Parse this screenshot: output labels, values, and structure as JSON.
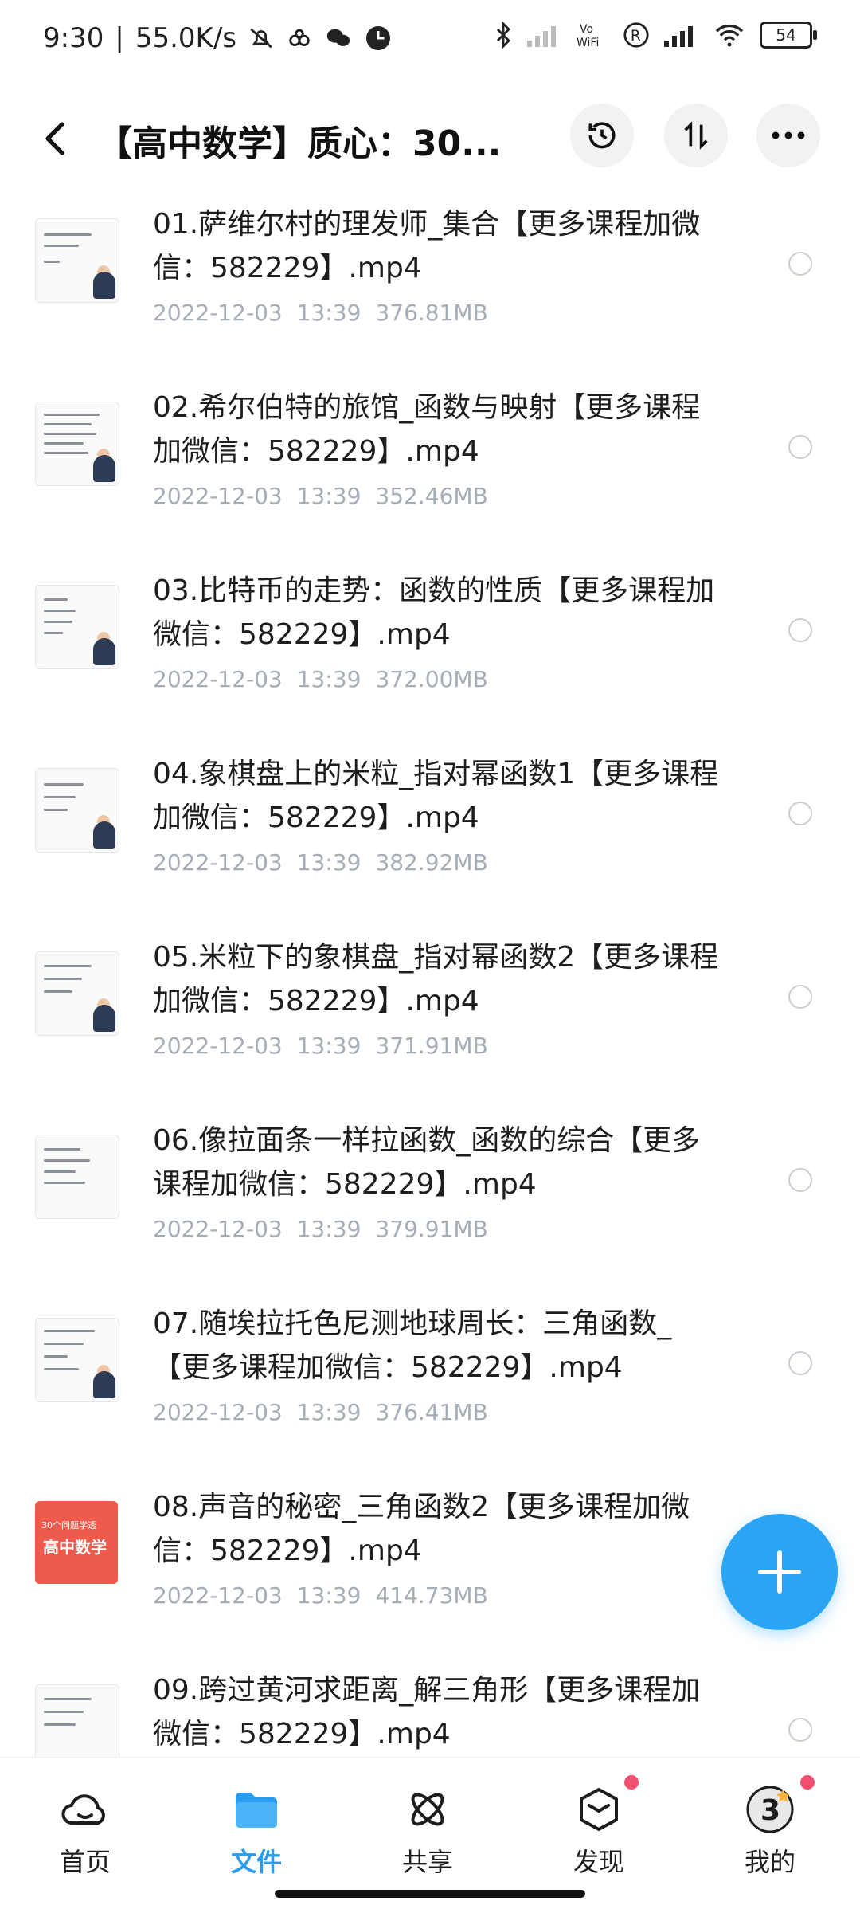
{
  "status_bar": {
    "time": "9:30",
    "separator": "|",
    "net_speed": "55.0K/s",
    "battery": "54"
  },
  "header": {
    "title": "【高中数学】质心：30..."
  },
  "files": [
    {
      "name": "01.萨维尔村的理发师_集合【更多课程加微信：582229】.mp4",
      "date": "2022-12-03",
      "time": "13:39",
      "size": "376.81MB"
    },
    {
      "name": "02.希尔伯特的旅馆_函数与映射【更多课程加微信：582229】.mp4",
      "date": "2022-12-03",
      "time": "13:39",
      "size": "352.46MB"
    },
    {
      "name": "03.比特币的走势：函数的性质【更多课程加微信：582229】.mp4",
      "date": "2022-12-03",
      "time": "13:39",
      "size": "372.00MB"
    },
    {
      "name": "04.象棋盘上的米粒_指对幂函数1【更多课程加微信：582229】.mp4",
      "date": "2022-12-03",
      "time": "13:39",
      "size": "382.92MB"
    },
    {
      "name": "05.米粒下的象棋盘_指对幂函数2【更多课程加微信：582229】.mp4",
      "date": "2022-12-03",
      "time": "13:39",
      "size": "371.91MB"
    },
    {
      "name": "06.像拉面条一样拉函数_函数的综合【更多课程加微信：582229】.mp4",
      "date": "2022-12-03",
      "time": "13:39",
      "size": "379.91MB"
    },
    {
      "name": "07.随埃拉托色尼测地球周长：三角函数_【更多课程加微信：582229】.mp4",
      "date": "2022-12-03",
      "time": "13:39",
      "size": "376.41MB"
    },
    {
      "name": "08.声音的秘密_三角函数2【更多课程加微信：582229】.mp4",
      "date": "2022-12-03",
      "time": "13:39",
      "size": "414.73MB"
    },
    {
      "name": "09.跨过黄河求距离_解三角形【更多课程加微信：582229】.mp4",
      "date": "",
      "time": "",
      "size": ""
    }
  ],
  "thumb8": {
    "line1": "30个问题学透",
    "line2": "高中数学"
  },
  "nav": {
    "home": "首页",
    "files": "文件",
    "share": "共享",
    "discover": "发现",
    "mine": "我的",
    "avatar_badge": "3"
  },
  "colors": {
    "accent": "#2aa5f5",
    "badge": "#f2506e",
    "meta_text": "#a7adb7"
  }
}
